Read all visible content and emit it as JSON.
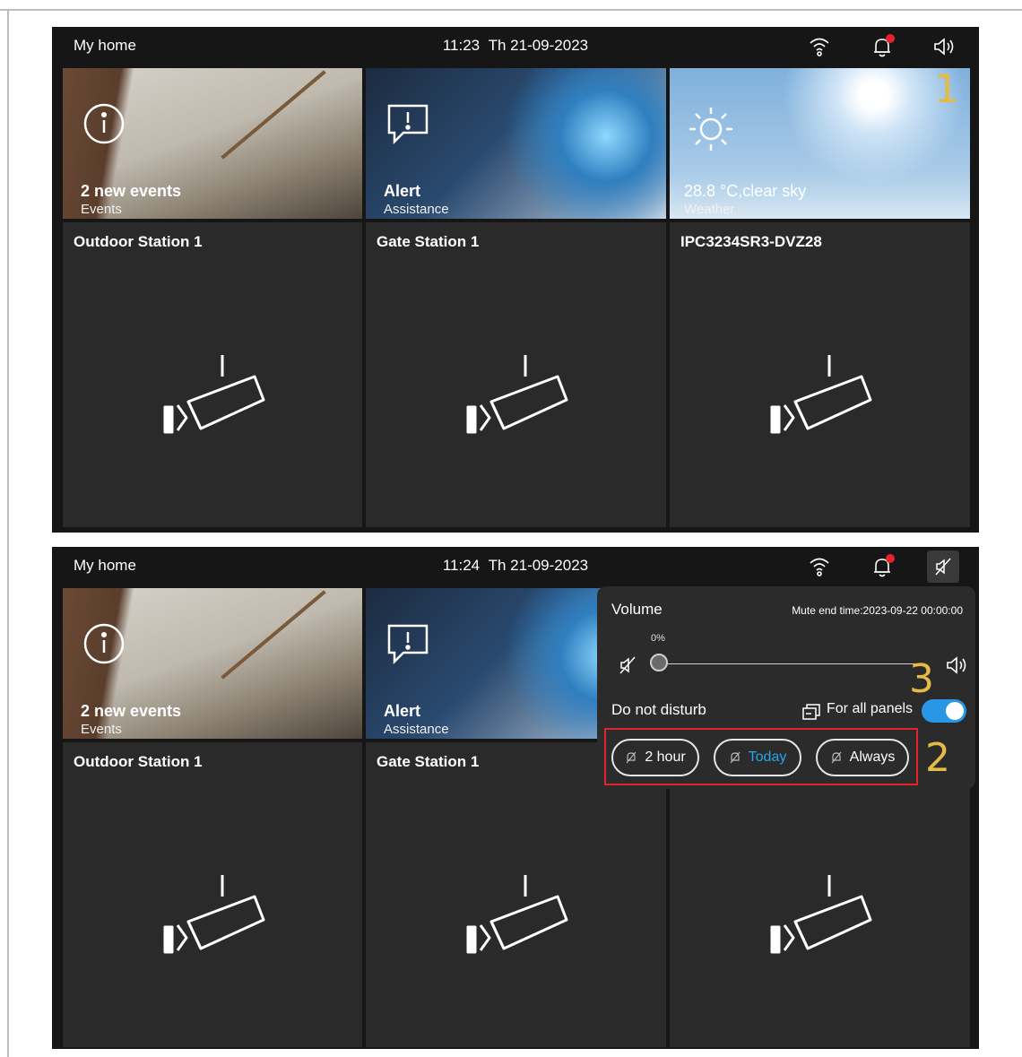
{
  "screens": [
    {
      "status": {
        "home": "My home",
        "time": "11:23",
        "date": "Th 21-09-2023"
      },
      "tiles": [
        {
          "title": "2 new events",
          "sub": "Events"
        },
        {
          "title": "Alert",
          "sub": "Assistance"
        },
        {
          "title": "28.8 °C,clear sky",
          "sub": "Weather"
        }
      ],
      "cameras": [
        "Outdoor Station 1",
        "Gate Station  1",
        "IPC3234SR3-DVZ28"
      ],
      "callout": "1"
    },
    {
      "status": {
        "home": "My home",
        "time": "11:24",
        "date": "Th 21-09-2023"
      },
      "tiles": [
        {
          "title": "2 new events",
          "sub": "Events"
        },
        {
          "title": "Alert",
          "sub": "Assistance"
        }
      ],
      "cameras": [
        "Outdoor Station 1",
        "Gate Station  1"
      ],
      "volume": {
        "title": "Volume",
        "mute_end": "Mute end time:2023-09-22 00:00:00",
        "percent": "0%",
        "level": 0,
        "dnd_label": "Do not disturb",
        "all_panels_label": "For all panels",
        "all_panels_on": true,
        "buttons": [
          "2 hour",
          "Today",
          "Always"
        ],
        "selected": "Today"
      },
      "callouts": [
        "2",
        "3"
      ]
    }
  ],
  "colors": {
    "accent": "#26a5ef",
    "alert_dot": "#e8222c",
    "highlight_box": "#e5222b",
    "callout": "#e3bb45"
  },
  "icons": [
    "wifi-icon",
    "bell-icon",
    "speaker-icon",
    "muted-speaker-icon",
    "info-icon",
    "alert-bubble-icon",
    "sun-icon",
    "camera-icon",
    "panels-icon"
  ]
}
